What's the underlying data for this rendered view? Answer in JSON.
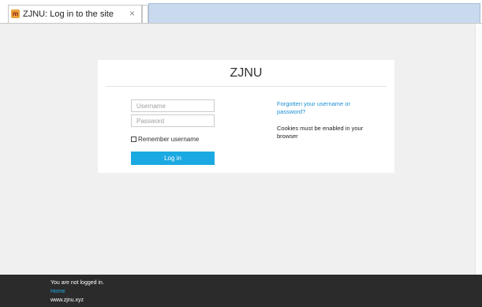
{
  "browser": {
    "tab_title": "ZJNU: Log in to the site",
    "tab_close": "×",
    "favicon_glyph": "m"
  },
  "login": {
    "site_title": "ZJNU",
    "username_placeholder": "Username",
    "password_placeholder": "Password",
    "remember_label": "Remember username",
    "login_button": "Log in",
    "forgot_link": "Forgotten your username or password?",
    "cookies_note": "Cookies must be enabled in your browser"
  },
  "footer": {
    "status": "You are not logged in.",
    "home_link": "Home",
    "url": "www.zjnu.xyz"
  },
  "colors": {
    "accent": "#1ba9e1",
    "footer_bg": "#2b2b2b",
    "page_bg": "#f0f0f0"
  }
}
